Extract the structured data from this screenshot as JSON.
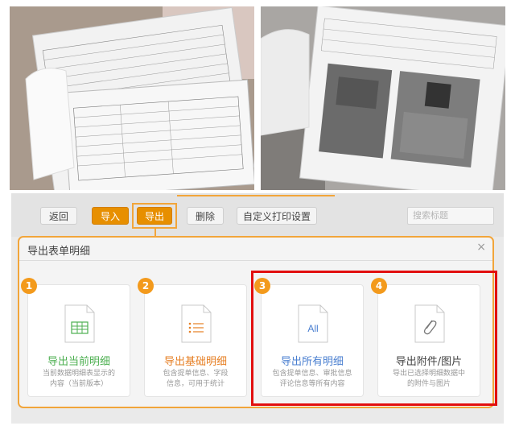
{
  "toolbar": {
    "back_label": "返回",
    "import_label": "导入",
    "export_label": "导出",
    "delete_label": "删除",
    "custom_print_label": "自定义打印设置",
    "search_placeholder": "搜索标题"
  },
  "dialog": {
    "title": "导出表单明细",
    "close_symbol": "×",
    "cards": [
      {
        "number": "1",
        "title": "导出当前明细",
        "desc_line1": "当前数据明细表显示的",
        "desc_line2": "内容（当前版本）",
        "icon": "table-file-icon",
        "color": "#4caf50"
      },
      {
        "number": "2",
        "title": "导出基础明细",
        "desc_line1": "包含提单信息、字段",
        "desc_line2": "信息，可用于统计",
        "icon": "list-file-icon",
        "color": "#e67e22"
      },
      {
        "number": "3",
        "title": "导出所有明细",
        "desc_line1": "包含提单信息、审批信息",
        "desc_line2": "评论信息等所有内容",
        "icon": "all-file-icon",
        "icon_text": "All",
        "color": "#4a7fd0"
      },
      {
        "number": "4",
        "title": "导出附件/图片",
        "desc_line1": "导出已选择明细数据中",
        "desc_line2": "的附件与图片",
        "icon": "attachment-file-icon",
        "color": "#444444"
      }
    ]
  },
  "colors": {
    "orange": "#f39a1c",
    "highlight": "#e20f0f"
  }
}
